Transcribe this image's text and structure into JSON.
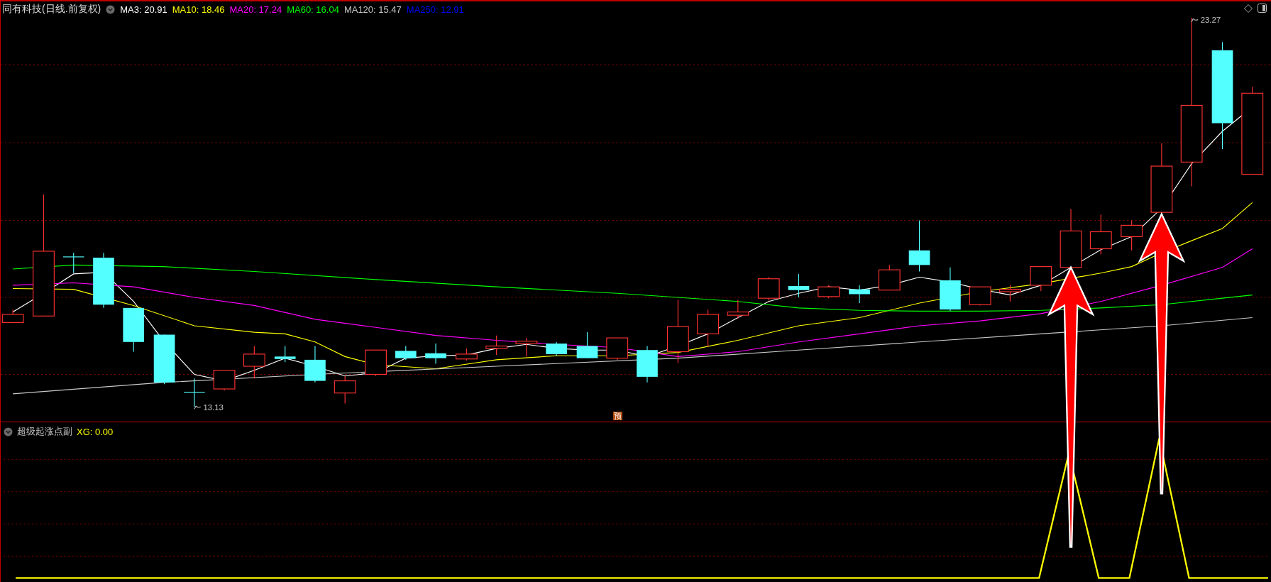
{
  "chart_header": {
    "title": "同有科技(日线.前复权)",
    "legend": [
      {
        "label": "MA3: 20.91",
        "color": "#ffffff"
      },
      {
        "label": "MA10: 18.46",
        "color": "#ffff00"
      },
      {
        "label": "MA20: 17.24",
        "color": "#ff00ff"
      },
      {
        "label": "MA60: 16.04",
        "color": "#00ff00"
      },
      {
        "label": "MA120: 15.47",
        "color": "#c8c8c8"
      },
      {
        "label": "MA250: 12.91",
        "color": "#0000ff"
      }
    ]
  },
  "price_labels": [
    {
      "text": "23.27"
    },
    {
      "text": "13.13"
    }
  ],
  "forecast_badge": "预",
  "indicator": {
    "title": "超级起涨点副",
    "reading": "XG: 0.00"
  }
}
